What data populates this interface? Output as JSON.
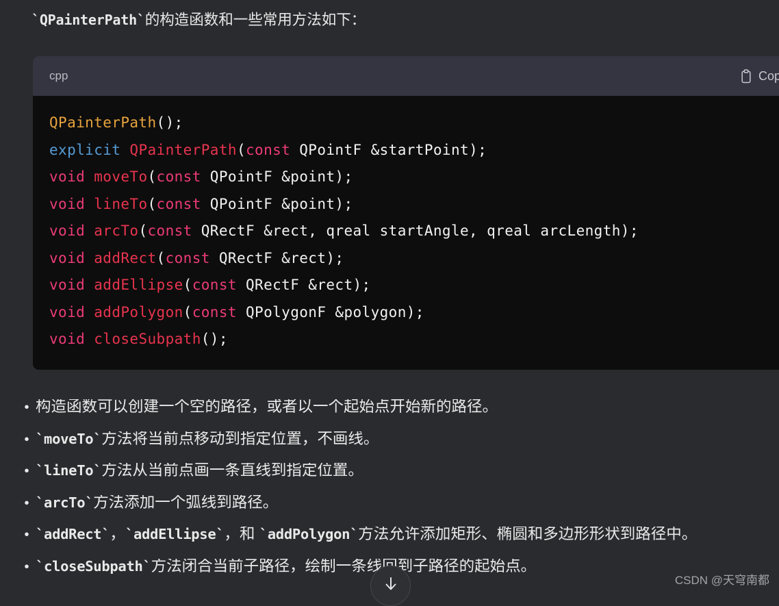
{
  "page": {
    "background_color": "#2a2b2e",
    "text_color": "#e9e9ea"
  },
  "intro": {
    "code_term": "`QPainterPath`",
    "rest": "的构造函数和一些常用方法如下："
  },
  "code_block": {
    "language_label": "cpp",
    "copy_button_label": "Copy co",
    "copy_icon": "clipboard-icon",
    "background_color": "#0d0d0d",
    "header_color": "#343541",
    "syntax_colors": {
      "class_ctor": "#e8a33d",
      "keyword": "#569cd6",
      "keyword_alt": "#ec3b78",
      "function": "#e8344e",
      "plain": "#f2f2f2"
    },
    "lines": [
      [
        {
          "t": "QPainterPath",
          "c": "tok-type"
        },
        {
          "t": "();",
          "c": "tok-plain"
        }
      ],
      [
        {
          "t": "explicit",
          "c": "tok-kw"
        },
        {
          "t": " ",
          "c": "tok-plain"
        },
        {
          "t": "QPainterPath",
          "c": "tok-fn"
        },
        {
          "t": "(",
          "c": "tok-plain"
        },
        {
          "t": "const",
          "c": "tok-kw2"
        },
        {
          "t": " QPointF &startPoint);",
          "c": "tok-plain"
        }
      ],
      [
        {
          "t": "void",
          "c": "tok-kw2"
        },
        {
          "t": " ",
          "c": "tok-plain"
        },
        {
          "t": "moveTo",
          "c": "tok-fn"
        },
        {
          "t": "(",
          "c": "tok-plain"
        },
        {
          "t": "const",
          "c": "tok-kw2"
        },
        {
          "t": " QPointF &point);",
          "c": "tok-plain"
        }
      ],
      [
        {
          "t": "void",
          "c": "tok-kw2"
        },
        {
          "t": " ",
          "c": "tok-plain"
        },
        {
          "t": "lineTo",
          "c": "tok-fn"
        },
        {
          "t": "(",
          "c": "tok-plain"
        },
        {
          "t": "const",
          "c": "tok-kw2"
        },
        {
          "t": " QPointF &point);",
          "c": "tok-plain"
        }
      ],
      [
        {
          "t": "void",
          "c": "tok-kw2"
        },
        {
          "t": " ",
          "c": "tok-plain"
        },
        {
          "t": "arcTo",
          "c": "tok-fn"
        },
        {
          "t": "(",
          "c": "tok-plain"
        },
        {
          "t": "const",
          "c": "tok-kw2"
        },
        {
          "t": " QRectF &rect, qreal startAngle, qreal arcLength);",
          "c": "tok-plain"
        }
      ],
      [
        {
          "t": "void",
          "c": "tok-kw2"
        },
        {
          "t": " ",
          "c": "tok-plain"
        },
        {
          "t": "addRect",
          "c": "tok-fn"
        },
        {
          "t": "(",
          "c": "tok-plain"
        },
        {
          "t": "const",
          "c": "tok-kw2"
        },
        {
          "t": " QRectF &rect);",
          "c": "tok-plain"
        }
      ],
      [
        {
          "t": "void",
          "c": "tok-kw2"
        },
        {
          "t": " ",
          "c": "tok-plain"
        },
        {
          "t": "addEllipse",
          "c": "tok-fn"
        },
        {
          "t": "(",
          "c": "tok-plain"
        },
        {
          "t": "const",
          "c": "tok-kw2"
        },
        {
          "t": " QRectF &rect);",
          "c": "tok-plain"
        }
      ],
      [
        {
          "t": "void",
          "c": "tok-kw2"
        },
        {
          "t": " ",
          "c": "tok-plain"
        },
        {
          "t": "addPolygon",
          "c": "tok-fn"
        },
        {
          "t": "(",
          "c": "tok-plain"
        },
        {
          "t": "const",
          "c": "tok-kw2"
        },
        {
          "t": " QPolygonF &polygon);",
          "c": "tok-plain"
        }
      ],
      [
        {
          "t": "void",
          "c": "tok-kw2"
        },
        {
          "t": " ",
          "c": "tok-plain"
        },
        {
          "t": "closeSubpath",
          "c": "tok-fn"
        },
        {
          "t": "();",
          "c": "tok-plain"
        }
      ]
    ]
  },
  "bullets": {
    "marker": "•",
    "items": [
      [
        {
          "t": "构造函数可以创建一个空的路径，或者以一个起始点开始新的路径。",
          "mono": false
        }
      ],
      [
        {
          "t": "`moveTo`",
          "mono": true
        },
        {
          "t": "方法将当前点移动到指定位置，不画线。",
          "mono": false
        }
      ],
      [
        {
          "t": "`lineTo`",
          "mono": true
        },
        {
          "t": "方法从当前点画一条直线到指定位置。",
          "mono": false
        }
      ],
      [
        {
          "t": "`arcTo`",
          "mono": true
        },
        {
          "t": "方法添加一个弧线到路径。",
          "mono": false
        }
      ],
      [
        {
          "t": "`addRect`",
          "mono": true
        },
        {
          "t": "，",
          "mono": false
        },
        {
          "t": "`addEllipse`",
          "mono": true
        },
        {
          "t": "，和 ",
          "mono": false
        },
        {
          "t": "`addPolygon`",
          "mono": true
        },
        {
          "t": "方法允许添加矩形、椭圆和多边形形状到路径中。",
          "mono": false
        }
      ],
      [
        {
          "t": "`closeSubpath`",
          "mono": true
        },
        {
          "t": "方法闭合当前子路径，绘制一条线回到子路径的起始点。",
          "mono": false
        }
      ]
    ]
  },
  "scroll_button": {
    "icon": "arrow-down-icon"
  },
  "watermark": {
    "text": "CSDN @天穹南都"
  }
}
